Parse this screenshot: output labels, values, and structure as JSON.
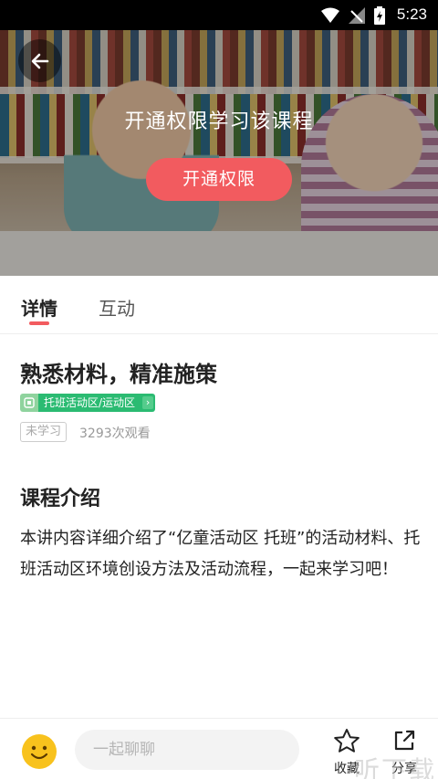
{
  "status_bar": {
    "time": "5:23"
  },
  "hero": {
    "title": "开通权限学习该课程",
    "unlock_button": "开通权限"
  },
  "tabs": [
    {
      "label": "详情",
      "active": true
    },
    {
      "label": "互动",
      "active": false
    }
  ],
  "course": {
    "title": "熟悉材料，精准施策",
    "tag": "托班活动区/运动区",
    "status": "未学习",
    "views": "3293次观看"
  },
  "intro": {
    "heading": "课程介绍",
    "body": "本讲内容详细介绍了“亿童活动区 托班”的活动材料、托班活动区环境创设方法及活动流程，一起来学习吧！"
  },
  "bottom_bar": {
    "chat_placeholder": "一起聊聊",
    "favorite_label": "收藏",
    "share_label": "分享"
  },
  "watermark": "听下载",
  "colors": {
    "accent": "#f25b5f",
    "tag_green": "#2bbb72",
    "emoji_yellow": "#f8c21d"
  },
  "icons": [
    "wifi-icon",
    "signal-icon",
    "battery-icon",
    "back-arrow-icon",
    "emoji-icon",
    "star-icon",
    "share-icon"
  ]
}
